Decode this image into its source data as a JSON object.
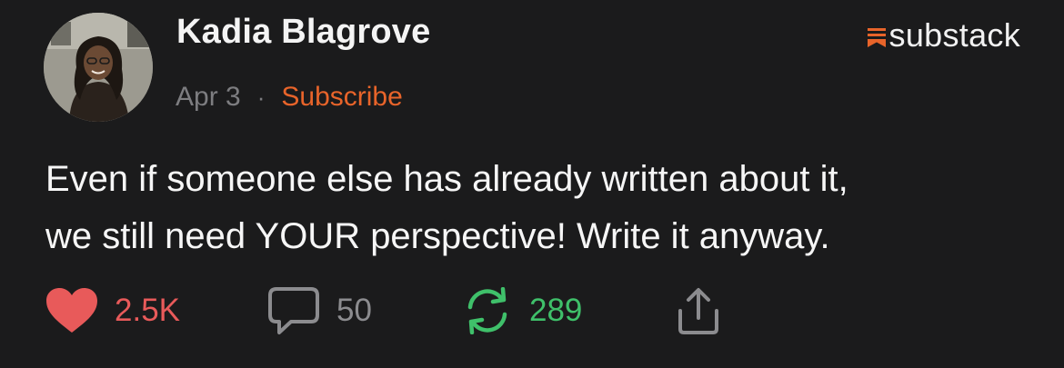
{
  "author": {
    "name": "Kadia Blagrove"
  },
  "meta": {
    "date": "Apr 3",
    "separator": "·",
    "subscribe_label": "Subscribe"
  },
  "brand": {
    "name": "substack",
    "icon": "substack-logo-icon",
    "color": "#e8642a"
  },
  "post": {
    "lines": [
      "Even if someone else has already written about it,",
      "we still need YOUR perspective! Write it anyway."
    ]
  },
  "actions": {
    "likes": {
      "icon": "heart-icon",
      "count": "2.5K",
      "color": "#e85a5a"
    },
    "comments": {
      "icon": "comment-icon",
      "count": "50",
      "color": "#8c8c8f"
    },
    "restacks": {
      "icon": "restack-icon",
      "count": "289",
      "color": "#3fc06a"
    },
    "share": {
      "icon": "share-icon"
    }
  },
  "colors": {
    "background": "#1b1b1c",
    "text": "#f4f4f4",
    "muted": "#7d7d80",
    "accent": "#e8642a"
  }
}
